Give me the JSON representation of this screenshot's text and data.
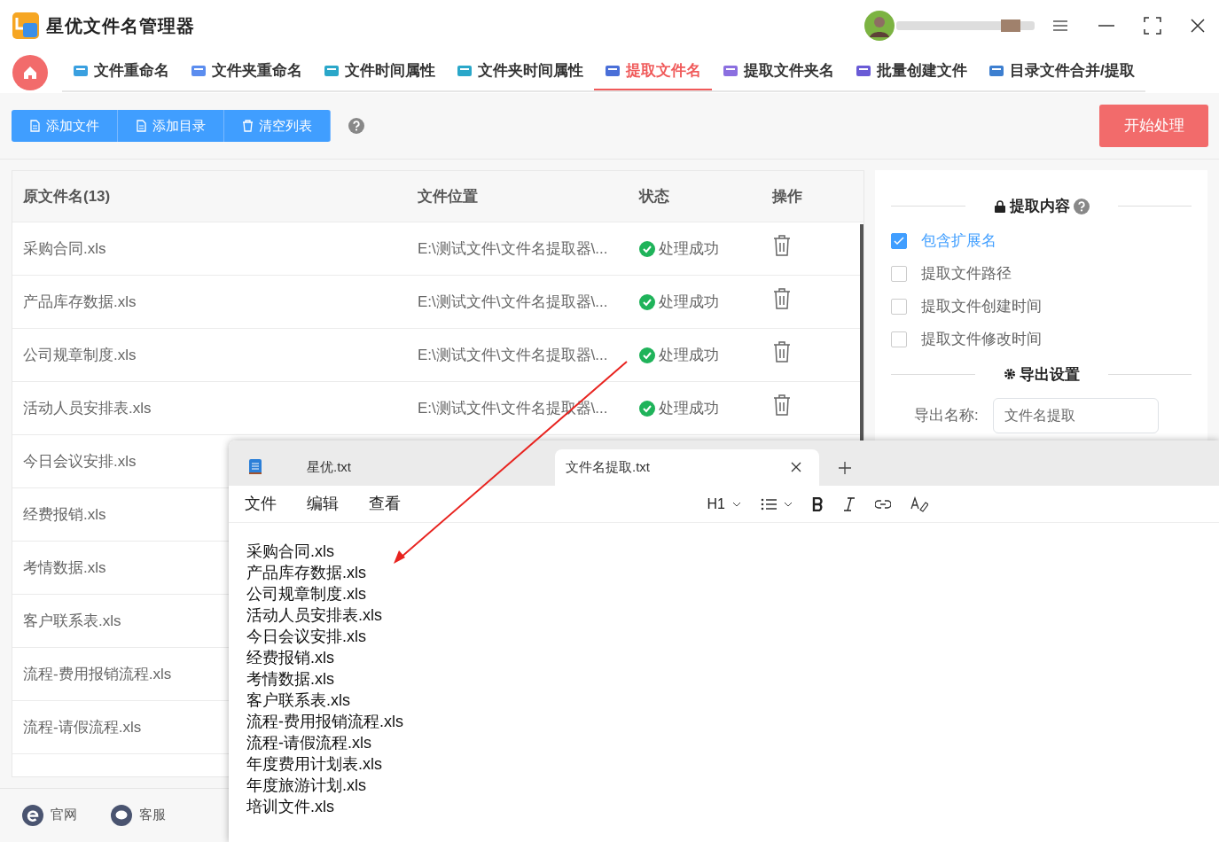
{
  "app": {
    "title": "星优文件名管理器",
    "nav": [
      {
        "label": "文件重命名",
        "selected": false
      },
      {
        "label": "文件夹重命名",
        "selected": false
      },
      {
        "label": "文件时间属性",
        "selected": false
      },
      {
        "label": "文件夹时间属性",
        "selected": false
      },
      {
        "label": "提取文件名",
        "selected": true
      },
      {
        "label": "提取文件夹名",
        "selected": false
      },
      {
        "label": "批量创建文件",
        "selected": false
      },
      {
        "label": "目录文件合并/提取",
        "selected": false
      }
    ],
    "toolbar": [
      {
        "label": "添加文件",
        "kind": "file"
      },
      {
        "label": "添加目录",
        "kind": "file"
      },
      {
        "label": "清空列表",
        "kind": "trash"
      }
    ],
    "start_button": "开始处理",
    "table": {
      "columns": [
        "原文件名(13)",
        "文件位置",
        "状态",
        "操作"
      ],
      "rows": [
        {
          "name": "采购合同.xls",
          "location": "E:\\测试文件\\文件名提取器\\...",
          "status": "处理成功"
        },
        {
          "name": "产品库存数据.xls",
          "location": "E:\\测试文件\\文件名提取器\\...",
          "status": "处理成功"
        },
        {
          "name": "公司规章制度.xls",
          "location": "E:\\测试文件\\文件名提取器\\...",
          "status": "处理成功"
        },
        {
          "name": "活动人员安排表.xls",
          "location": "E:\\测试文件\\文件名提取器\\...",
          "status": "处理成功"
        },
        {
          "name": "今日会议安排.xls"
        },
        {
          "name": "经费报销.xls"
        },
        {
          "name": "考情数据.xls"
        },
        {
          "name": "客户联系表.xls"
        },
        {
          "name": "流程-费用报销流程.xls"
        },
        {
          "name": "流程-请假流程.xls"
        }
      ]
    },
    "options": {
      "title": "提取内容",
      "items": [
        {
          "label": "包含扩展名",
          "checked": true
        },
        {
          "label": "提取文件路径",
          "checked": false
        },
        {
          "label": "提取文件创建时间",
          "checked": false
        },
        {
          "label": "提取文件修改时间",
          "checked": false
        }
      ]
    },
    "export": {
      "title": "导出设置",
      "name_label": "导出名称:",
      "name_value": "文件名提取"
    },
    "footer": [
      {
        "label": "官网",
        "kind": "web"
      },
      {
        "label": "客服",
        "kind": "chat"
      }
    ]
  },
  "notepad": {
    "tabs": [
      {
        "label": "星优.txt",
        "selected": false
      },
      {
        "label": "文件名提取.txt",
        "selected": true
      }
    ],
    "menu": [
      "文件",
      "编辑",
      "查看"
    ],
    "heading": "H1",
    "lines": [
      "采购合同.xls",
      "产品库存数据.xls",
      "公司规章制度.xls",
      "活动人员安排表.xls",
      "今日会议安排.xls",
      "经费报销.xls",
      "考情数据.xls",
      "客户联系表.xls",
      "流程-费用报销流程.xls",
      "流程-请假流程.xls",
      "年度费用计划表.xls",
      "年度旅游计划.xls",
      "培训文件.xls"
    ]
  }
}
